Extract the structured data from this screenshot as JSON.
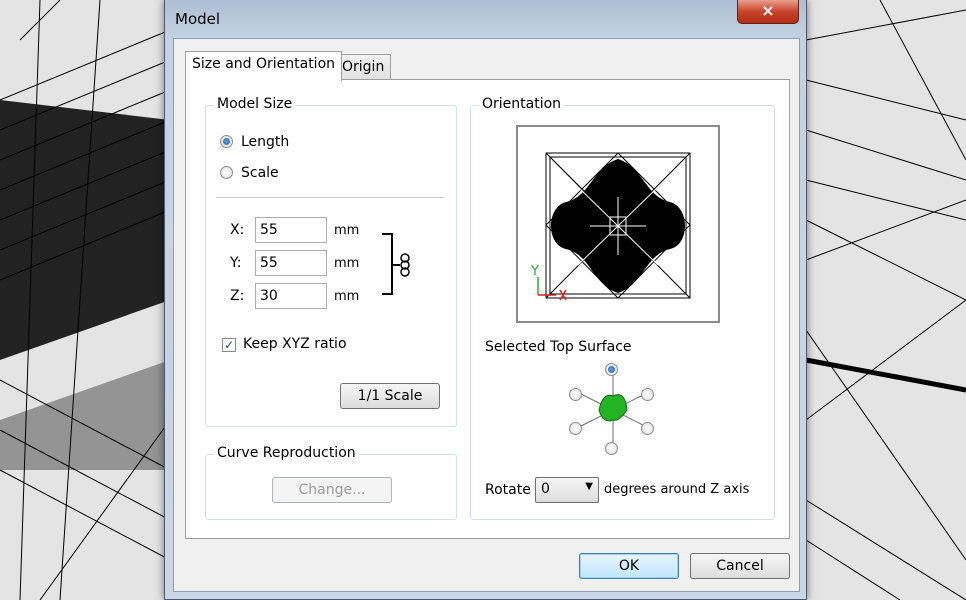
{
  "window": {
    "title": "Model",
    "close_label": "×"
  },
  "tabs": [
    {
      "label": "Size and Orientation",
      "active": true
    },
    {
      "label": "Origin",
      "active": false
    }
  ],
  "model_size": {
    "legend": "Model Size",
    "options": [
      {
        "label": "Length",
        "checked": true
      },
      {
        "label": "Scale",
        "checked": false
      }
    ],
    "fields": [
      {
        "axis": "X:",
        "value": "55",
        "unit": "mm"
      },
      {
        "axis": "Y:",
        "value": "55",
        "unit": "mm"
      },
      {
        "axis": "Z:",
        "value": "30",
        "unit": "mm"
      }
    ],
    "keep_ratio_label": "Keep XYZ ratio",
    "keep_ratio_checked": true,
    "scale_button": "1/1 Scale"
  },
  "curve_reproduction": {
    "legend": "Curve Reproduction",
    "change_button": "Change..."
  },
  "orientation": {
    "legend": "Orientation",
    "axis_y": "Y",
    "selected_top_surface_label": "Selected Top Surface",
    "rotate_label": "Rotate",
    "rotate_value": "0",
    "rotate_suffix": "degrees around Z axis"
  },
  "footer": {
    "ok": "OK",
    "cancel": "Cancel"
  },
  "colors": {
    "accent_green": "#22b422",
    "axis_red": "#e02020"
  }
}
